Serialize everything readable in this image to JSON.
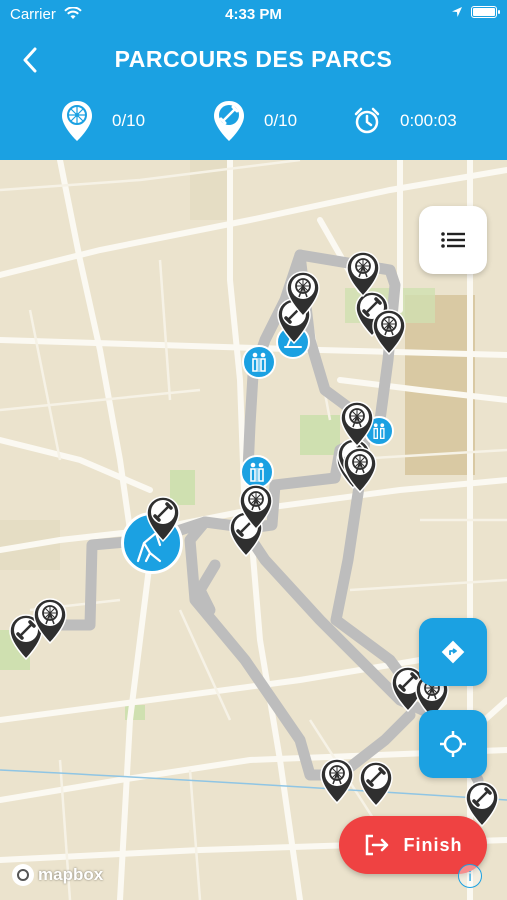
{
  "status_bar": {
    "carrier": "Carrier",
    "time": "4:33 PM",
    "icons": [
      "wifi-icon",
      "location-arrow-icon",
      "battery-icon"
    ]
  },
  "nav": {
    "title": "PARCOURS DES PARCS",
    "back_icon": "chevron-left-icon"
  },
  "stats": [
    {
      "icon": "ferris-wheel-pin-icon",
      "value": "0/10"
    },
    {
      "icon": "fitness-pin-icon",
      "value": "0/10"
    },
    {
      "icon": "alarm-clock-icon",
      "value": "0:00:03"
    }
  ],
  "map": {
    "controls": {
      "list_icon": "list-icon",
      "directions_icon": "directions-icon",
      "locate_icon": "crosshair-icon"
    },
    "finish_label": "Finish",
    "attribution": "mapbox",
    "info_label": "i",
    "pins": {
      "fitness": "dumbbell-icon",
      "ferris": "ferris-wheel-icon",
      "facility": "restroom-icon",
      "start": "stretching-person-icon"
    }
  },
  "colors": {
    "primary": "#1ba1e2",
    "finish": "#ef4242",
    "pin": "#2f2f2f",
    "route": "#bfbfbf"
  }
}
